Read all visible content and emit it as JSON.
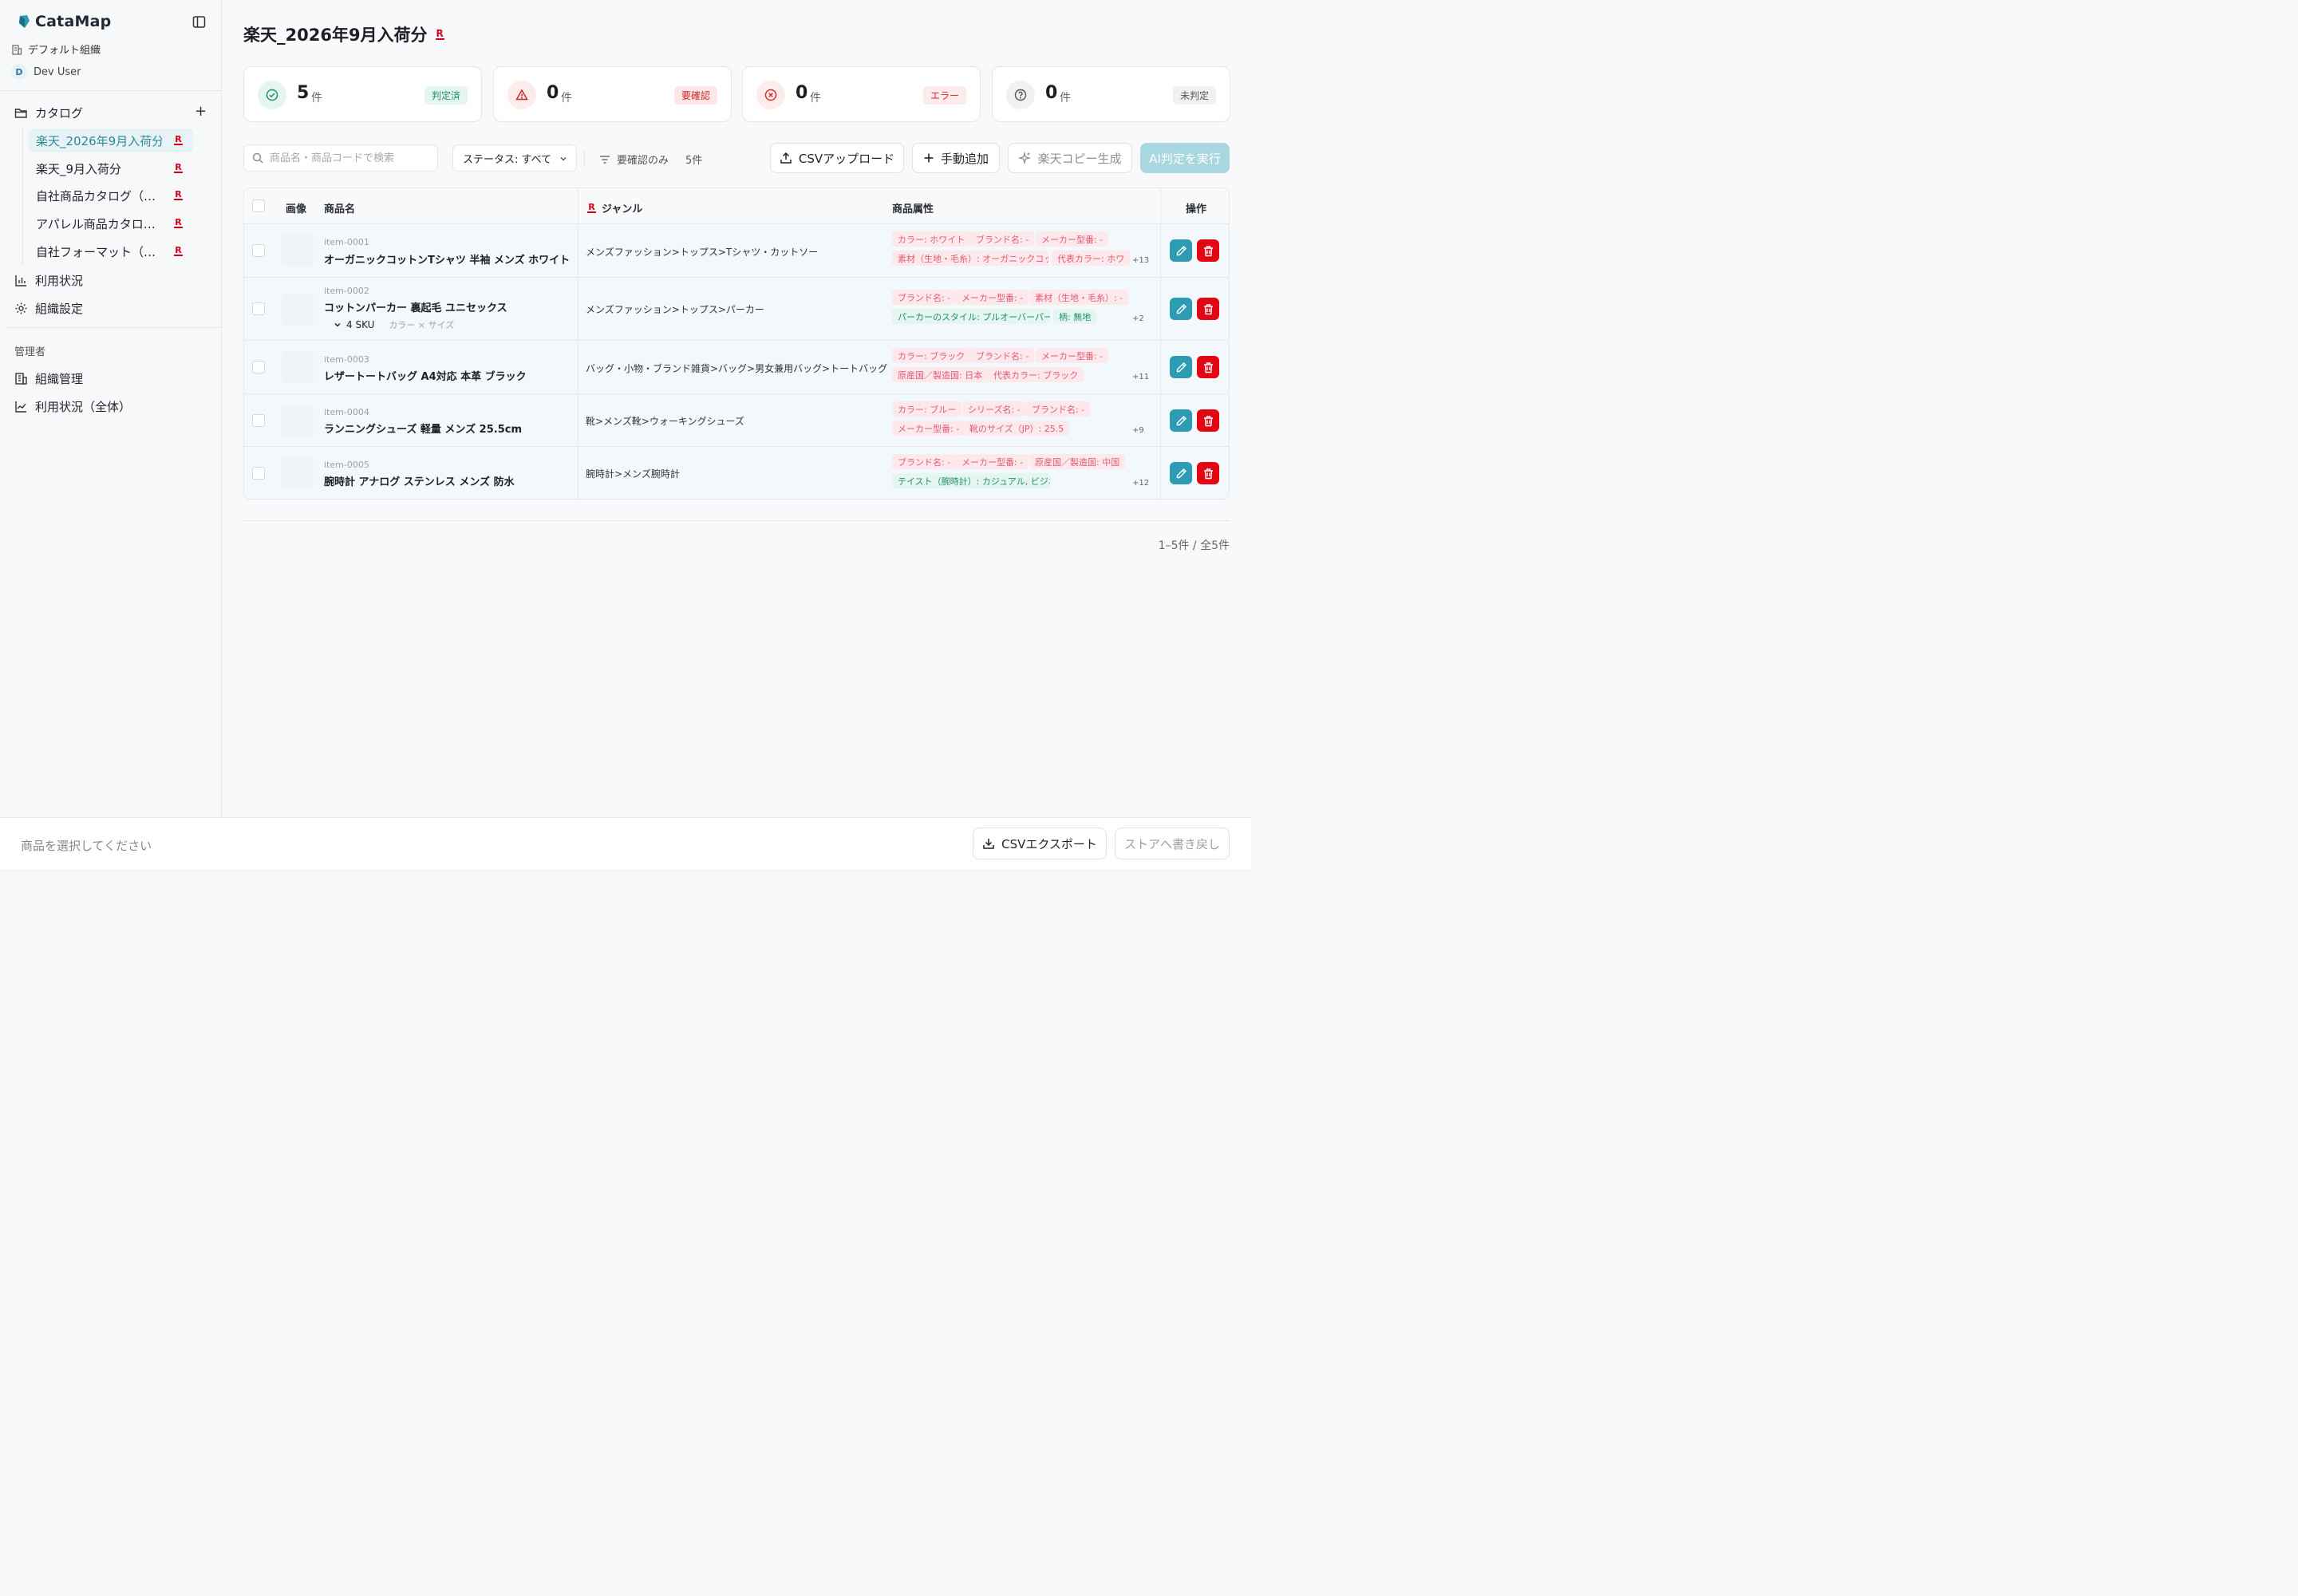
{
  "brand": {
    "name": "CataMap",
    "color": "#2d9bb1"
  },
  "org": {
    "name": "デフォルト組織"
  },
  "user": {
    "initial": "D",
    "name": "Dev User"
  },
  "sidebar": {
    "catalog_label": "カタログ",
    "add_symbol": "+",
    "catalogs": [
      {
        "label": "楽天_2026年9月入荷分",
        "badge": "R",
        "active": true
      },
      {
        "label": "楽天_9月入荷分",
        "badge": "R",
        "active": false
      },
      {
        "label": "自社商品カタログ（…",
        "badge": "R",
        "active": false
      },
      {
        "label": "アパレル商品カタロ…",
        "badge": "R",
        "active": false
      },
      {
        "label": "自社フォーマット（…",
        "badge": "R",
        "active": false
      }
    ],
    "usage_label": "利用状況",
    "org_settings_label": "組織設定",
    "admin_section_label": "管理者",
    "org_manage_label": "組織管理",
    "usage_all_label": "利用状況（全体）"
  },
  "page": {
    "title": "楽天_2026年9月入荷分",
    "title_badge": "R"
  },
  "stats": [
    {
      "value": "5",
      "unit": "件",
      "badge": "判定済",
      "badge_color": "#1f8f6d",
      "badge_bg": "#e5f6f1",
      "icon": "check-circle-icon"
    },
    {
      "value": "0",
      "unit": "件",
      "badge": "要確認",
      "badge_color": "#c62828",
      "badge_bg": "#fde8e8",
      "icon": "warning-icon"
    },
    {
      "value": "0",
      "unit": "件",
      "badge": "エラー",
      "badge_color": "#d32f2f",
      "badge_bg": "#fdeaea",
      "icon": "x-circle-icon"
    },
    {
      "value": "0",
      "unit": "件",
      "badge": "未判定",
      "badge_color": "#555555",
      "badge_bg": "#f0f1f3",
      "icon": "question-circle-icon"
    }
  ],
  "toolbar": {
    "search_placeholder": "商品名・商品コードで検索",
    "status_filter": "ステータス: すべて",
    "needs_review_only": "要確認のみ",
    "count": "5件",
    "csv_upload": "CSVアップロード",
    "manual_add": "手動追加",
    "rakuten_copy": "楽天コピー生成",
    "ai_judge": "AI判定を実行"
  },
  "table": {
    "headers": {
      "image": "画像",
      "name": "商品名",
      "genre": "ジャンル",
      "attributes": "商品属性",
      "actions": "操作"
    },
    "rows": [
      {
        "code": "item-0001",
        "name": "オーガニックコットンTシャツ 半袖 メンズ ホワイト",
        "genre": "メンズファッション>トップス>Tシャツ・カットソー",
        "tags": [
          {
            "text": "カラー: ホワイト",
            "color": "pink"
          },
          {
            "text": "ブランド名: -",
            "color": "pink"
          },
          {
            "text": "メーカー型番: -",
            "color": "pink"
          },
          {
            "text": "素材（生地・毛糸）: オーガニックコッ",
            "color": "pink"
          },
          {
            "text": "代表カラー: ホワ",
            "color": "pink"
          }
        ],
        "more": "+13"
      },
      {
        "code": "item-0002",
        "name": "コットンパーカー 裏起毛 ユニセックス",
        "sku": "4 SKU",
        "sku_sub": "カラー × サイズ",
        "genre": "メンズファッション>トップス>パーカー",
        "tags": [
          {
            "text": "ブランド名: -",
            "color": "pink"
          },
          {
            "text": "メーカー型番: -",
            "color": "pink"
          },
          {
            "text": "素材（生地・毛糸）: -",
            "color": "pink"
          },
          {
            "text": "パーカーのスタイル: プルオーバーパー",
            "color": "green"
          },
          {
            "text": "柄: 無地",
            "color": "green"
          }
        ],
        "more": "+2"
      },
      {
        "code": "item-0003",
        "name": "レザートートバッグ A4対応 本革 ブラック",
        "genre": "バッグ・小物・ブランド雑貨>バッグ>男女兼用バッグ>トートバッグ",
        "tags": [
          {
            "text": "カラー: ブラック",
            "color": "pink"
          },
          {
            "text": "ブランド名: -",
            "color": "pink"
          },
          {
            "text": "メーカー型番: -",
            "color": "pink"
          },
          {
            "text": "原産国／製造国: 日本",
            "color": "pink"
          },
          {
            "text": "代表カラー: ブラック",
            "color": "pink"
          }
        ],
        "more": "+11"
      },
      {
        "code": "item-0004",
        "name": "ランニングシューズ 軽量 メンズ 25.5cm",
        "genre": "靴>メンズ靴>ウォーキングシューズ",
        "tags": [
          {
            "text": "カラー: ブルー",
            "color": "pink"
          },
          {
            "text": "シリーズ名: -",
            "color": "pink"
          },
          {
            "text": "ブランド名: -",
            "color": "pink"
          },
          {
            "text": "メーカー型番: -",
            "color": "pink"
          },
          {
            "text": "靴のサイズ（JP）: 25.5",
            "color": "pink"
          }
        ],
        "more": "+9"
      },
      {
        "code": "item-0005",
        "name": "腕時計 アナログ ステンレス メンズ 防水",
        "genre": "腕時計>メンズ腕時計",
        "tags": [
          {
            "text": "ブランド名: -",
            "color": "pink"
          },
          {
            "text": "メーカー型番: -",
            "color": "pink"
          },
          {
            "text": "原産国／製造国: 中国",
            "color": "pink"
          },
          {
            "text": "テイスト（腕時計）: カジュアル, ビジネ",
            "color": "green"
          }
        ],
        "more": "+12"
      }
    ]
  },
  "pagination": "1–5件 / 全5件",
  "footer": {
    "hint": "商品を選択してください",
    "csv_export": "CSVエクスポート",
    "store_writeback": "ストアへ書き戻し"
  },
  "colors": {
    "accent": "#2d9bb1",
    "danger": "#e30613",
    "rakuten": "#d0021b"
  }
}
